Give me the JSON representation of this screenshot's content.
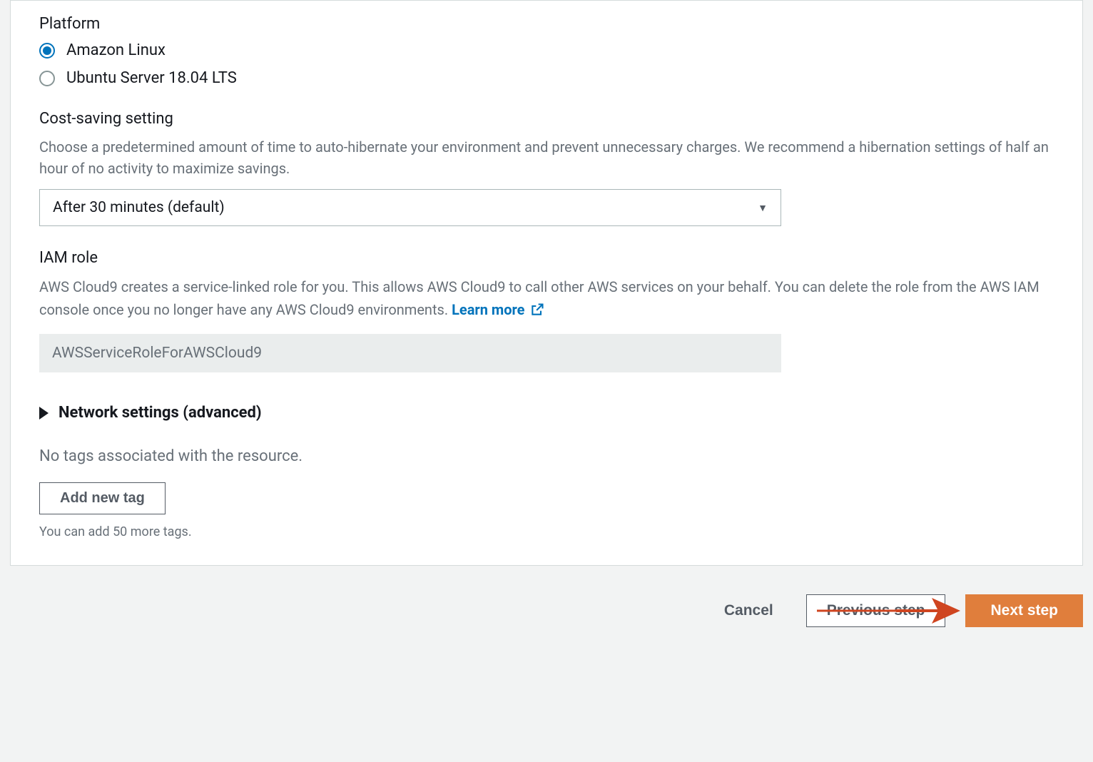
{
  "platform": {
    "title": "Platform",
    "options": [
      {
        "label": "Amazon Linux",
        "selected": true
      },
      {
        "label": "Ubuntu Server 18.04 LTS",
        "selected": false
      }
    ]
  },
  "cost_saving": {
    "title": "Cost-saving setting",
    "description": "Choose a predetermined amount of time to auto-hibernate your environment and prevent unnecessary charges. We recommend a hibernation settings of half an hour of no activity to maximize savings.",
    "selected": "After 30 minutes (default)"
  },
  "iam": {
    "title": "IAM role",
    "description": "AWS Cloud9 creates a service-linked role for you. This allows AWS Cloud9 to call other AWS services on your behalf. You can delete the role from the AWS IAM console once you no longer have any AWS Cloud9 environments. ",
    "learn_more": "Learn more",
    "role_value": "AWSServiceRoleForAWSCloud9"
  },
  "network": {
    "label": "Network settings (advanced)"
  },
  "tags": {
    "empty_text": "No tags associated with the resource.",
    "add_button": "Add new tag",
    "hint": "You can add 50 more tags."
  },
  "footer": {
    "cancel": "Cancel",
    "previous": "Previous step",
    "next": "Next step"
  }
}
